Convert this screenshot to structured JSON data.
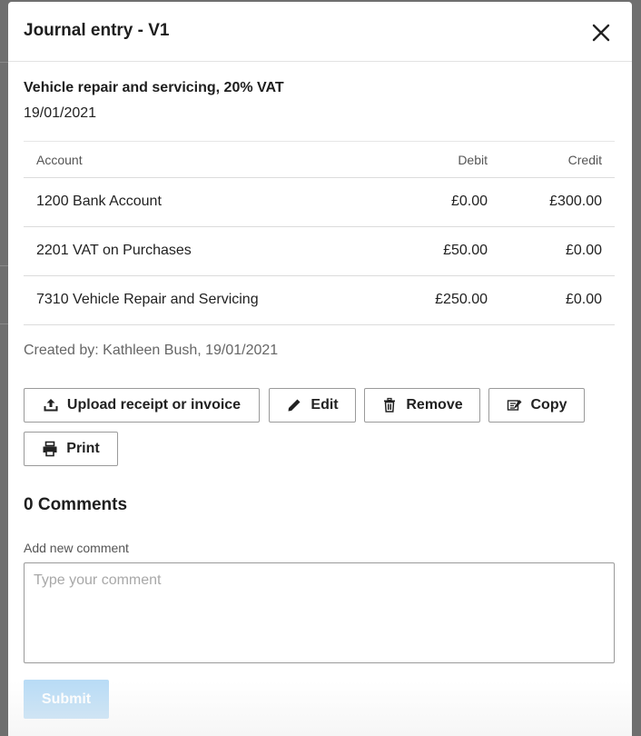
{
  "modal": {
    "title": "Journal entry - V1"
  },
  "entry": {
    "description": "Vehicle repair and servicing, 20% VAT",
    "date": "19/01/2021"
  },
  "table": {
    "headers": {
      "account": "Account",
      "debit": "Debit",
      "credit": "Credit"
    },
    "rows": [
      {
        "account": "1200 Bank Account",
        "debit": "£0.00",
        "credit": "£300.00"
      },
      {
        "account": "2201 VAT on Purchases",
        "debit": "£50.00",
        "credit": "£0.00"
      },
      {
        "account": "7310 Vehicle Repair and Servicing",
        "debit": "£250.00",
        "credit": "£0.00"
      }
    ]
  },
  "created_by": "Created by: Kathleen Bush, 19/01/2021",
  "actions": {
    "upload_label": "Upload receipt or invoice",
    "edit_label": "Edit",
    "remove_label": "Remove",
    "copy_label": "Copy",
    "print_label": "Print"
  },
  "comments": {
    "title": "0 Comments",
    "add_label": "Add new comment",
    "placeholder": "Type your comment",
    "submit_label": "Submit"
  },
  "icons": {
    "close": "close-icon",
    "upload": "upload-icon",
    "edit": "pencil-icon",
    "remove": "trash-icon",
    "copy": "copy-icon",
    "print": "printer-icon"
  },
  "colors": {
    "submit_disabled": "#b9dcf6",
    "overlay": "#6f6f6f"
  }
}
